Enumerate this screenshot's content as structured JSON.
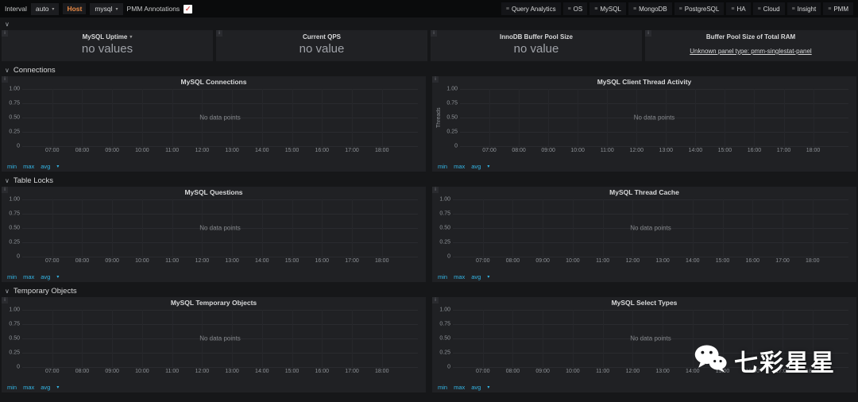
{
  "icons": {
    "menu": "≡",
    "caret_down": "▾",
    "chevron_down": "∨",
    "check": "✓",
    "info": "i"
  },
  "colors": {
    "accent_link": "#33b5e5",
    "host_label": "#eb8a44",
    "check": "#d9534f",
    "panel_bg": "#202124",
    "body_bg": "#161719"
  },
  "topbar": {
    "interval": {
      "label": "Interval",
      "value": "auto"
    },
    "host": {
      "label": "Host",
      "value": "mysql"
    },
    "annotations": {
      "label": "PMM Annotations",
      "checked": true
    },
    "nav_buttons": [
      {
        "label": "Query Analytics"
      },
      {
        "label": "OS"
      },
      {
        "label": "MySQL"
      },
      {
        "label": "MongoDB"
      },
      {
        "label": "PostgreSQL"
      },
      {
        "label": "HA"
      },
      {
        "label": "Cloud"
      },
      {
        "label": "Insight"
      },
      {
        "label": "PMM"
      }
    ]
  },
  "stat_row": {
    "panels": [
      {
        "title": "MySQL Uptime",
        "value": "no values"
      },
      {
        "title": "Current QPS",
        "value": "no value"
      },
      {
        "title": "InnoDB Buffer Pool Size",
        "value": "no value"
      },
      {
        "title": "Buffer Pool Size of Total RAM",
        "value": "",
        "error_text": "Unknown panel type: pmm-singlestat-panel"
      }
    ]
  },
  "sections": [
    {
      "title": "Connections",
      "panels": [
        {
          "title": "MySQL Connections",
          "ylabel": ""
        },
        {
          "title": "MySQL Client Thread Activity",
          "ylabel": "Threads"
        }
      ]
    },
    {
      "title": "Table Locks",
      "panels": [
        {
          "title": "MySQL Questions",
          "ylabel": ""
        },
        {
          "title": "MySQL Thread Cache",
          "ylabel": ""
        }
      ]
    },
    {
      "title": "Temporary Objects",
      "panels": [
        {
          "title": "MySQL Temporary Objects",
          "ylabel": ""
        },
        {
          "title": "MySQL Select Types",
          "ylabel": ""
        }
      ]
    }
  ],
  "chart": {
    "no_data_text": "No data points",
    "y_ticks": [
      "1.00",
      "0.75",
      "0.50",
      "0.25",
      "0"
    ],
    "x_ticks": [
      "07:00",
      "08:00",
      "09:00",
      "10:00",
      "11:00",
      "12:00",
      "13:00",
      "14:00",
      "15:00",
      "16:00",
      "17:00",
      "18:00"
    ],
    "legend_items": [
      "min",
      "max",
      "avg"
    ]
  },
  "watermark": {
    "text": "七彩星星"
  }
}
